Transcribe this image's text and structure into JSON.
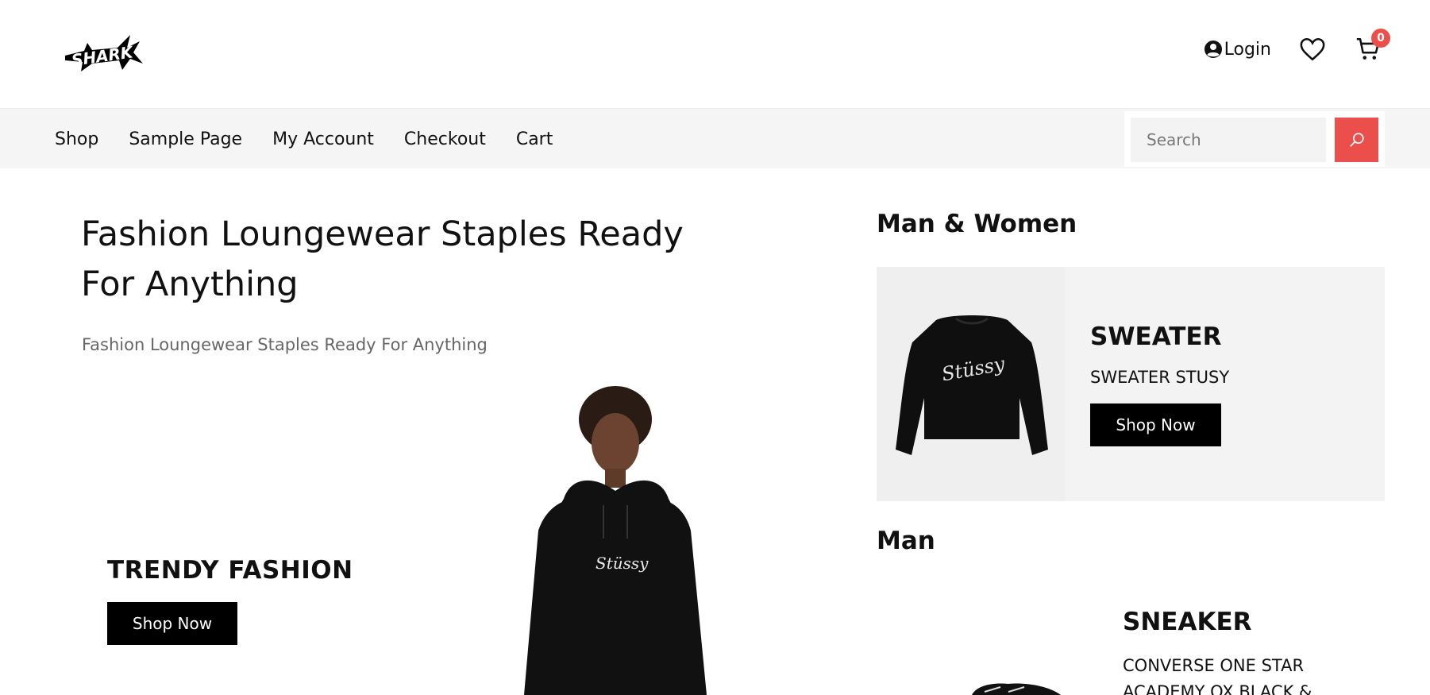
{
  "header": {
    "brand": "SHARK",
    "login_label": "Login",
    "cart_count": "0"
  },
  "nav": {
    "items": [
      {
        "label": "Shop"
      },
      {
        "label": "Sample Page"
      },
      {
        "label": "My Account"
      },
      {
        "label": "Checkout"
      },
      {
        "label": "Cart"
      }
    ],
    "search_placeholder": "Search"
  },
  "hero": {
    "title": "Fashion Loungewear Staples Ready For Anything",
    "subtitle": "Fashion Loungewear Staples Ready For Anything",
    "promo_title": "TRENDY FASHION",
    "button_label": "Shop Now"
  },
  "sections": {
    "man_women": {
      "heading": "Man & Women",
      "title": "SWEATER",
      "subtitle": "SWEATER STUSY",
      "button_label": "Shop Now"
    },
    "man": {
      "heading": "Man",
      "title": "SNEAKER",
      "subtitle": "CONVERSE ONE STAR ACADEMY OX BLACK &"
    }
  },
  "colors": {
    "accent": "#ea4f4c",
    "nav_bg": "#f5f5f5",
    "button_bg": "#000000"
  }
}
